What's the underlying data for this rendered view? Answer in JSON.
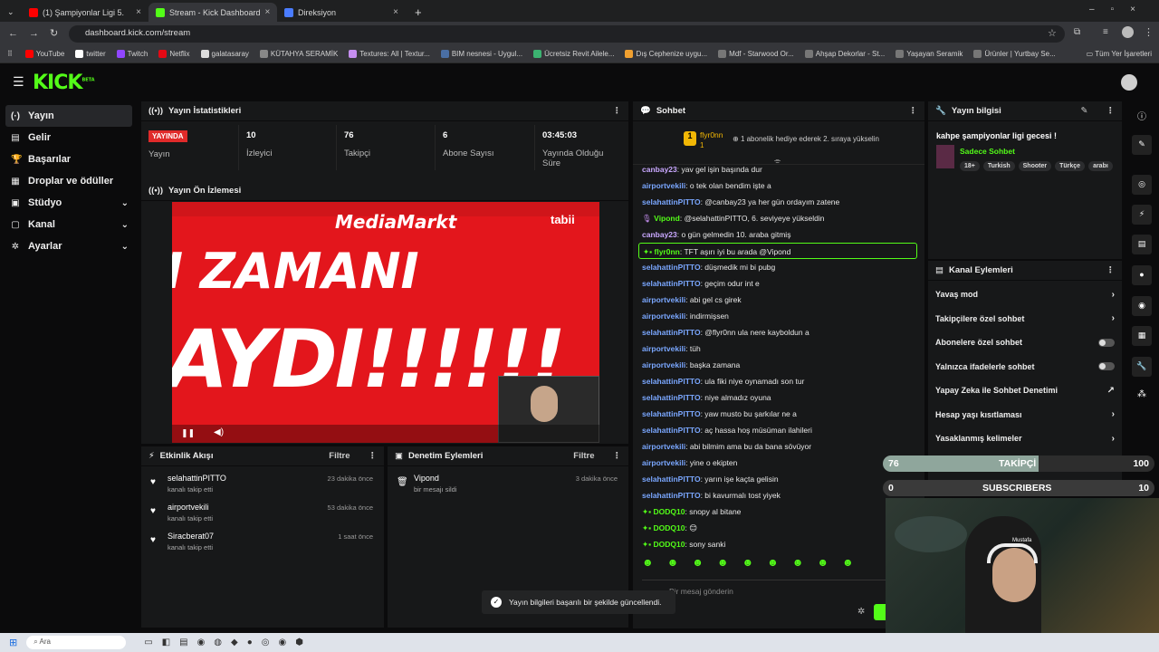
{
  "browser": {
    "tabs": [
      {
        "label": "(1) Şampiyonlar Ligi 5. Haft",
        "color": "#ff0000"
      },
      {
        "label": "Stream - Kick Dashboard",
        "color": "#53fc18"
      },
      {
        "label": "Direksiyon",
        "color": "#4a7cff"
      }
    ],
    "url": "dashboard.kick.com/stream",
    "bookmarks": [
      {
        "label": "YouTube",
        "color": "#ff0000"
      },
      {
        "label": "twitter",
        "color": "#ffffff"
      },
      {
        "label": "Twitch",
        "color": "#9146ff"
      },
      {
        "label": "Netflix",
        "color": "#e50914"
      },
      {
        "label": "galatasaray",
        "color": "#dddddd"
      },
      {
        "label": "KÜTAHYA SERAMİK",
        "color": "#888888"
      },
      {
        "label": "Textures: All | Textur...",
        "color": "#c58ef0"
      },
      {
        "label": "BIM nesnesi - Uygul...",
        "color": "#4a6fa5"
      },
      {
        "label": "Ücretsiz Revit Ailele...",
        "color": "#3cb371"
      },
      {
        "label": "Dış Cephenize uygu...",
        "color": "#f0a030"
      },
      {
        "label": "Mdf - Starwood Or...",
        "color": "#777777"
      },
      {
        "label": "Ahşap Dekorlar - St...",
        "color": "#777777"
      },
      {
        "label": "Yaşayan Seramik",
        "color": "#777777"
      },
      {
        "label": "Ürünler | Yurtbay Se...",
        "color": "#777777"
      }
    ],
    "all_bookmarks": "Tüm Yer İşaretleri"
  },
  "app": {
    "logo": "KICK",
    "logo_sup": "BETA"
  },
  "sidebar": {
    "items": [
      {
        "label": "Yayın",
        "icon": "broadcast-icon",
        "glyph": "(·)"
      },
      {
        "label": "Gelir",
        "icon": "wallet-icon",
        "glyph": "▤"
      },
      {
        "label": "Başarılar",
        "icon": "trophy-icon",
        "glyph": "🏆"
      },
      {
        "label": "Droplar ve ödüller",
        "icon": "gift-icon",
        "glyph": "▦"
      },
      {
        "label": "Stüdyo",
        "icon": "studio-icon",
        "glyph": "▣"
      },
      {
        "label": "Kanal",
        "icon": "channel-icon",
        "glyph": "▢"
      },
      {
        "label": "Ayarlar",
        "icon": "settings-icon",
        "glyph": "✲"
      }
    ]
  },
  "stats": {
    "title": "Yayın İstatistikleri",
    "live_badge": "YAYINDA",
    "live_label": "Yayın",
    "items": [
      {
        "value": "10",
        "label": "İzleyici"
      },
      {
        "value": "76",
        "label": "Takipçi"
      },
      {
        "value": "6",
        "label": "Abone Sayısı"
      },
      {
        "value": "03:45:03",
        "label": "Yayında Olduğu Süre"
      }
    ]
  },
  "preview": {
    "title": "Yayın Ön İzlemesi",
    "big1": "I ZAMANI",
    "big2": "AYDI!!!!!!",
    "brand": "MediaMarkt",
    "channel": "tabii"
  },
  "activity": {
    "title": "Etkinlik Akışı",
    "filter": "Filtre",
    "items": [
      {
        "name": "selahattinPITTO",
        "sub": "kanalı takip etti",
        "time": "23 dakika önce"
      },
      {
        "name": "airportvekili",
        "sub": "kanalı takip etti",
        "time": "53 dakika önce"
      },
      {
        "name": "Siracberat07",
        "sub": "kanalı takip etti",
        "time": "1 saat önce"
      }
    ]
  },
  "moderation": {
    "title": "Denetim Eylemleri",
    "filter": "Filtre",
    "items": [
      {
        "name": "Vipond",
        "sub": "bir mesajı sildi",
        "time": "3 dakika önce"
      }
    ]
  },
  "chat": {
    "title": "Sohbet",
    "pinned_user": "flyr0nn",
    "pinned_count": "1",
    "pinned_text": "1 abonelik hediye ederek 2. sıraya yükselin",
    "messages": [
      {
        "user": "canbay23",
        "color": "#c9a8ff",
        "text": "yav gel işin başında dur"
      },
      {
        "user": "airportvekili",
        "color": "#7aa7ff",
        "text": "o tek olan bendim işte a"
      },
      {
        "user": "selahattinPITTO",
        "color": "#7aa7ff",
        "text": "@canbay23 ya her gün ordayım zatene"
      },
      {
        "user": "Vipond",
        "color": "#53fc18",
        "text": "@selahattinPITTO, 6. seviyeye yükseldin"
      },
      {
        "user": "canbay23",
        "color": "#c9a8ff",
        "text": "o gün gelmedin 10. araba gitmiş"
      },
      {
        "user": "flyr0nn",
        "color": "#53fc18",
        "text": "TFT aşırı iyi bu arada @Vipond"
      },
      {
        "user": "selahattinPITTO",
        "color": "#7aa7ff",
        "text": "düşmedik mi bi pubg"
      },
      {
        "user": "selahattinPITTO",
        "color": "#7aa7ff",
        "text": "geçim odur int e"
      },
      {
        "user": "airportvekili",
        "color": "#7aa7ff",
        "text": "abi gel cs girek"
      },
      {
        "user": "airportvekili",
        "color": "#7aa7ff",
        "text": "indirmişsen"
      },
      {
        "user": "selahattinPITTO",
        "color": "#7aa7ff",
        "text": "@flyr0nn ula nere kayboldun a"
      },
      {
        "user": "airportvekili",
        "color": "#7aa7ff",
        "text": "tüh"
      },
      {
        "user": "airportvekili",
        "color": "#7aa7ff",
        "text": "başka zamana"
      },
      {
        "user": "selahattinPITTO",
        "color": "#7aa7ff",
        "text": "ula fiki niye oynamadı son tur"
      },
      {
        "user": "selahattinPITTO",
        "color": "#7aa7ff",
        "text": "niye almadız oyuna"
      },
      {
        "user": "selahattinPITTO",
        "color": "#7aa7ff",
        "text": "yaw musto bu şarkılar ne a"
      },
      {
        "user": "selahattinPITTO",
        "color": "#7aa7ff",
        "text": "aç hassa hoş müsüman ilahileri"
      },
      {
        "user": "airportvekili",
        "color": "#7aa7ff",
        "text": "abi bilmim ama bu da bana sövüyor"
      },
      {
        "user": "airportvekili",
        "color": "#7aa7ff",
        "text": "yine o ekipten"
      },
      {
        "user": "selahattinPITTO",
        "color": "#7aa7ff",
        "text": "yarın işe kaçta gelisin"
      },
      {
        "user": "selahattinPITTO",
        "color": "#7aa7ff",
        "text": "bi kavurmalı tost yiyek"
      },
      {
        "user": "DODQ10",
        "color": "#53fc18",
        "text": "snopy al bitane"
      },
      {
        "user": "DODQ10",
        "color": "#53fc18",
        "text": "😊"
      },
      {
        "user": "DODQ10",
        "color": "#53fc18",
        "text": "sony sanki"
      }
    ],
    "input_placeholder": "Bir mesaj gönderin"
  },
  "stream_info": {
    "title": "Yayın bilgisi",
    "stream_title": "kahpe şampiyonlar ligi gecesi !",
    "category": "Sadece Sohbet",
    "tags": [
      "18+",
      "Turkish",
      "Shooter",
      "Türkçe",
      "arabı"
    ]
  },
  "channel_actions": {
    "title": "Kanal Eylemleri",
    "rows": [
      {
        "label": "Yavaş mod",
        "type": "chevron"
      },
      {
        "label": "Takipçilere özel sohbet",
        "type": "chevron"
      },
      {
        "label": "Abonelere özel sohbet",
        "type": "toggle"
      },
      {
        "label": "Yalnızca ifadelerle sohbet",
        "type": "toggle"
      },
      {
        "label": "Yapay Zeka ile Sohbet Denetimi",
        "type": "external"
      },
      {
        "label": "Hesap yaşı kısıtlaması",
        "type": "chevron"
      },
      {
        "label": "Yasaklanmış kelimeler",
        "type": "chevron"
      },
      {
        "label": "Hedefleri belirle",
        "type": "chevron"
      }
    ]
  },
  "overlay": {
    "follow": {
      "current": "76",
      "label": "TAKİPÇİ",
      "goal": "100",
      "progress": 0.76
    },
    "subs": {
      "current": "0",
      "label": "SUBSCRIBERS",
      "goal": "10",
      "progress": 0
    },
    "cam_label": "Mustafa"
  },
  "toast": "Yayın bilgileri başarılı bir şekilde güncellendi.",
  "taskbar": {
    "search": "Ara"
  }
}
